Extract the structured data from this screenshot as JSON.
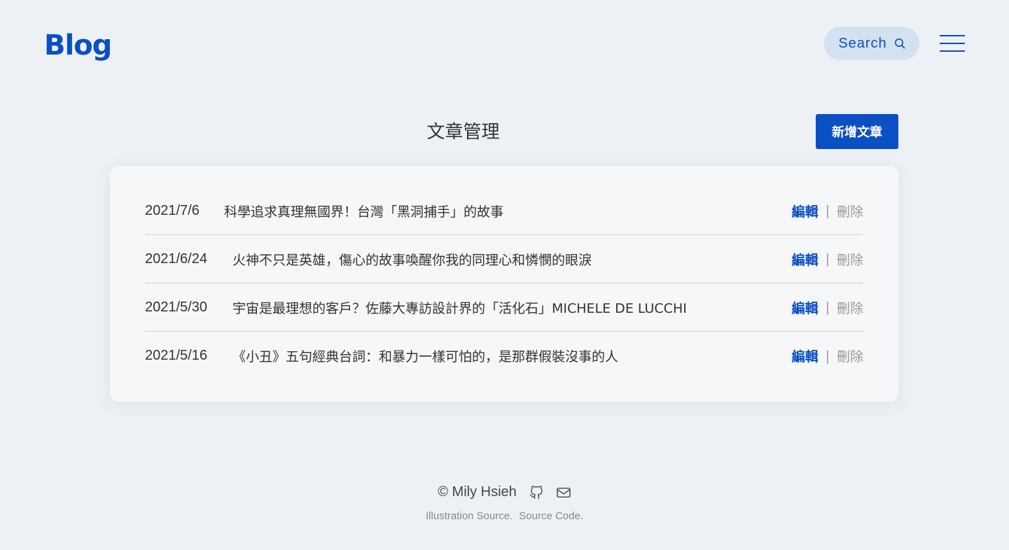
{
  "header": {
    "logo": "Blog",
    "search_label": "Search"
  },
  "main": {
    "title": "文章管理",
    "new_post_label": "新增文章"
  },
  "posts": [
    {
      "date": "2021/7/6",
      "title": "科學追求真理無國界！台灣「黑洞捕手」的故事",
      "edit": "編輯",
      "separator": "|",
      "delete": "刪除"
    },
    {
      "date": "2021/6/24",
      "title": "火神不只是英雄，傷心的故事喚醒你我的同理心和憐憫的眼淚",
      "edit": "編輯",
      "separator": "|",
      "delete": "刪除"
    },
    {
      "date": "2021/5/30",
      "title": "宇宙是最理想的客戶？佐藤大專訪設計界的「活化石」MICHELE DE LUCCHI",
      "edit": "編輯",
      "separator": "|",
      "delete": "刪除"
    },
    {
      "date": "2021/5/16",
      "title": "《小丑》五句經典台詞：和暴力一樣可怕的，是那群假裝沒事的人",
      "edit": "編輯",
      "separator": "|",
      "delete": "刪除"
    }
  ],
  "footer": {
    "copyright": "© Mily Hsieh",
    "illustration_link": "Illustration Source.",
    "source_link": "Source Code.",
    "icons": [
      "github-icon",
      "mail-icon"
    ]
  },
  "colors": {
    "accent": "#0a4fc4",
    "background": "#edf1f5",
    "card": "#f5f7f9",
    "search_bg": "#d4e1f1",
    "muted": "#999999"
  }
}
